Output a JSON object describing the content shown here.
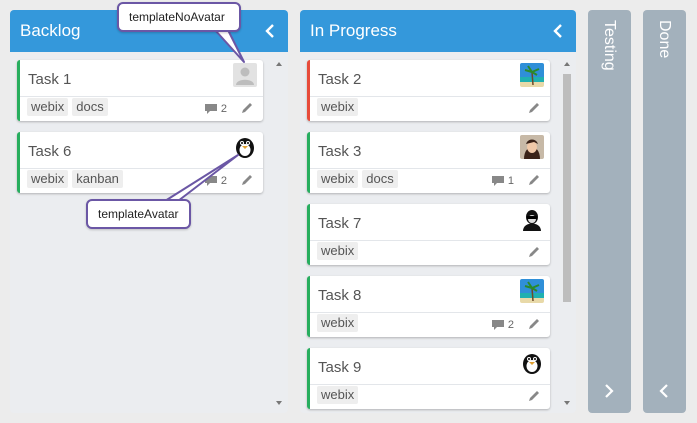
{
  "columns": {
    "backlog": {
      "title": "Backlog"
    },
    "in_progress": {
      "title": "In Progress"
    },
    "testing": {
      "title": "Testing"
    },
    "done": {
      "title": "Done"
    }
  },
  "backlog_cards": [
    {
      "title": "Task 1",
      "tags": [
        "webix",
        "docs"
      ],
      "comments": "2",
      "avatar": "default-user"
    },
    {
      "title": "Task 6",
      "tags": [
        "webix",
        "kanban"
      ],
      "comments": "2",
      "avatar": "penguin"
    }
  ],
  "progress_cards": [
    {
      "title": "Task 2",
      "tags": [
        "webix"
      ],
      "comments": "",
      "avatar": "beach",
      "status_color": "#e74c3c"
    },
    {
      "title": "Task 3",
      "tags": [
        "webix",
        "docs"
      ],
      "comments": "1",
      "avatar": "woman-portrait"
    },
    {
      "title": "Task 7",
      "tags": [
        "webix"
      ],
      "comments": "",
      "avatar": "man-portrait"
    },
    {
      "title": "Task 8",
      "tags": [
        "webix"
      ],
      "comments": "2",
      "avatar": "beach"
    },
    {
      "title": "Task 9",
      "tags": [
        "webix"
      ],
      "comments": "",
      "avatar": "penguin"
    }
  ],
  "callouts": {
    "no_avatar": "templateNoAvatar",
    "avatar": "templateAvatar"
  },
  "colors": {
    "header_blue": "#3498db",
    "collapsed_gray": "#a3b1bc",
    "status_green": "#27ae60",
    "status_red": "#e74c3c",
    "callout_border": "#6b57a5"
  },
  "icons": [
    "chevron-left-icon",
    "chevron-right-icon",
    "comment-icon",
    "pencil-icon",
    "user-placeholder-icon",
    "scroll-up-arrow-icon",
    "scroll-down-arrow-icon"
  ]
}
